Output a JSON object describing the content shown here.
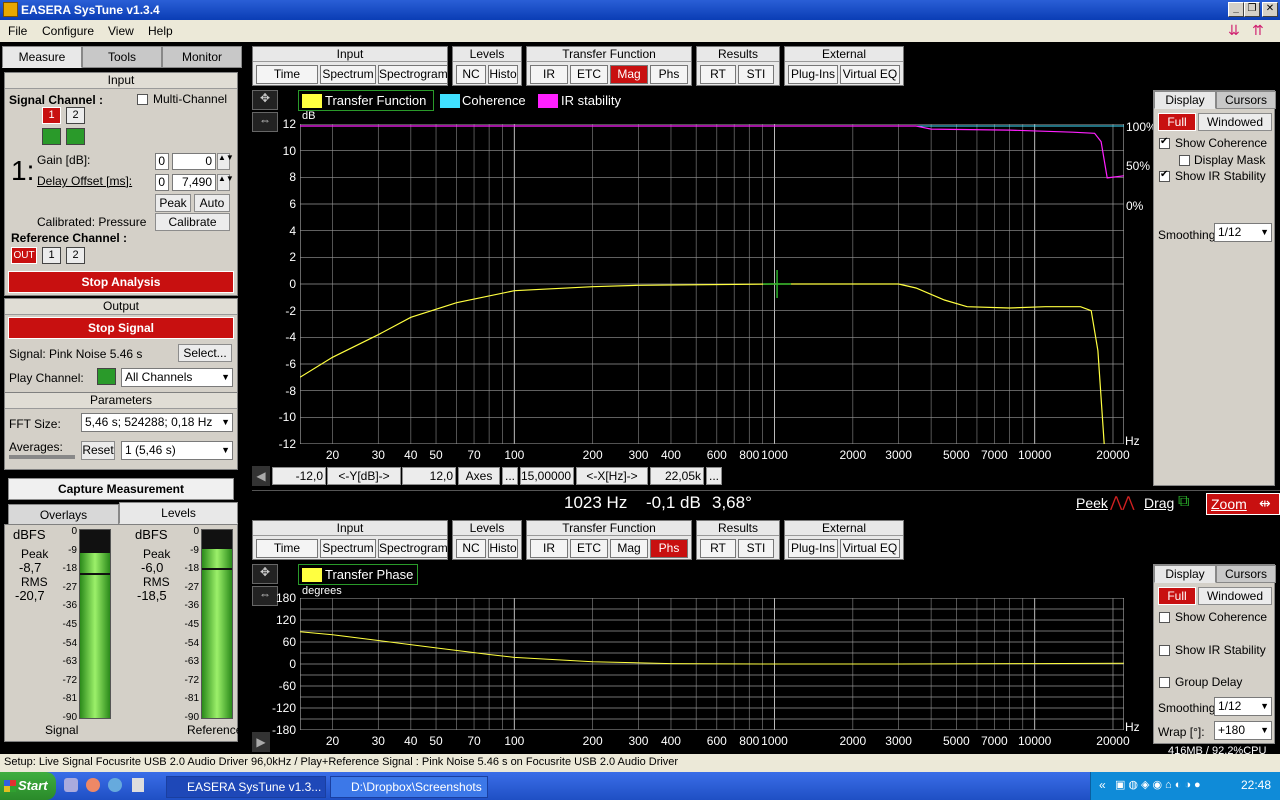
{
  "window": {
    "title": "EASERA SysTune v1.3.4"
  },
  "menu": [
    "File",
    "Configure",
    "View",
    "Help"
  ],
  "left_tabs": [
    "Measure",
    "Tools",
    "Monitor"
  ],
  "input": {
    "header": "Input",
    "signal_channel_label": "Signal Channel :",
    "multi_channel": "Multi-Channel",
    "channels": [
      "1",
      "2"
    ],
    "big_number": "1:",
    "gain_label": "Gain [dB]:",
    "gain_small": "0",
    "gain_value": "0",
    "delay_label": "Delay Offset [ms]:",
    "delay_small": "0",
    "delay_value": "7,490",
    "peak": "Peak",
    "auto": "Auto",
    "calibrated": "Calibrated: Pressure",
    "calibrate": "Calibrate",
    "reference_label": "Reference Channel :",
    "ref_channels": [
      "OUT",
      "1",
      "2"
    ],
    "stop_analysis": "Stop Analysis"
  },
  "output": {
    "header": "Output",
    "stop_signal": "Stop Signal",
    "signal": "Signal: Pink Noise  5.46 s",
    "select": "Select...",
    "play_channel": "Play Channel:",
    "play_value": "All Channels"
  },
  "parameters": {
    "header": "Parameters",
    "fft_label": "FFT Size:",
    "fft_value": "5,46 s; 524288; 0,18 Hz",
    "averages_label": "Averages:",
    "reset": "Reset",
    "avg_value": "1 (5,46 s)",
    "capture": "Capture Measurement"
  },
  "meters_tabs": [
    "Overlays",
    "Levels"
  ],
  "meters": [
    {
      "unit": "dBFS",
      "peak_label": "Peak",
      "peak": "-8,7",
      "rms_label": "RMS",
      "rms": "-20,7",
      "name": "Signal",
      "level": 0.88,
      "marker": 0.23
    },
    {
      "unit": "dBFS",
      "peak_label": "Peak",
      "peak": "-6,0",
      "rms_label": "RMS",
      "rms": "-18,5",
      "name": "Reference",
      "level": 0.9,
      "marker": 0.2
    }
  ],
  "meter_scale": [
    "0",
    "-9",
    "-18",
    "-27",
    "-36",
    "-45",
    "-54",
    "-63",
    "-72",
    "-81",
    "-90"
  ],
  "toolbar_top": {
    "groups": [
      {
        "title": "Input",
        "buttons": [
          "Time Signal",
          "Spectrum",
          "Spectrogram"
        ]
      },
      {
        "title": "Levels",
        "buttons": [
          "NC",
          "Histo"
        ]
      },
      {
        "title": "Transfer Function",
        "buttons": [
          "IR",
          "ETC",
          "Mag",
          "Phs"
        ]
      },
      {
        "title": "Results",
        "buttons": [
          "RT",
          "STI"
        ]
      },
      {
        "title": "External",
        "buttons": [
          "Plug-Ins",
          "Virtual EQ"
        ]
      }
    ],
    "active": "Mag"
  },
  "toolbar_bottom": {
    "active": "Phs"
  },
  "top_plot": {
    "legend": [
      "Transfer Function",
      "Coherence",
      "IR stability"
    ],
    "colors": {
      "tf": "#ffff40",
      "coh": "#40e0ff",
      "irs": "#ff20ff"
    },
    "yunit": "dB",
    "xunit": "Hz",
    "yticks": [
      "12",
      "10",
      "8",
      "6",
      "4",
      "2",
      "0",
      "-2",
      "-4",
      "-6",
      "-8",
      "-10",
      "-12"
    ],
    "right_ticks": [
      "100%",
      "50%",
      "0%"
    ],
    "xticks": [
      "20",
      "30",
      "40",
      "50",
      "70",
      "100",
      "200",
      "300",
      "400",
      "600",
      "800",
      "1000",
      "2000",
      "3000",
      "5000",
      "7000",
      "10000",
      "20000"
    ]
  },
  "axis_bar": {
    "ymin": "-12,0",
    "ylabel": "<-Y[dB]->",
    "ymax": "12,0",
    "axes": "Axes",
    "dots": "...",
    "xmin": "15,00000",
    "xlabel": "<-X[Hz]->",
    "xmax": "22,05k"
  },
  "readout": {
    "freq": "1023 Hz",
    "db": "-0,1 dB",
    "deg": "3,68°"
  },
  "modes": {
    "peek": "Peek",
    "drag": "Drag",
    "zoom": "Zoom"
  },
  "display_panel_top": {
    "tabs": [
      "Display",
      "Cursors"
    ],
    "full": "Full",
    "windowed": "Windowed",
    "show_coherence": "Show Coherence",
    "display_mask": "Display Mask",
    "show_ir": "Show IR Stability",
    "smoothing_label": "Smoothing:",
    "smoothing": "1/12"
  },
  "bottom_plot": {
    "legend": [
      "Transfer Phase"
    ],
    "yunit": "degrees",
    "yticks": [
      "180",
      "120",
      "60",
      "0",
      "-60",
      "-120",
      "-180"
    ]
  },
  "display_panel_bottom": {
    "tabs": [
      "Display",
      "Cursors"
    ],
    "full": "Full",
    "windowed": "Windowed",
    "show_coherence": "Show Coherence",
    "show_ir": "Show IR Stability",
    "group_delay": "Group Delay",
    "smoothing_label": "Smoothing:",
    "smoothing": "1/12",
    "wrap_label": "Wrap [°]:",
    "wrap": "+180"
  },
  "memory": "416MB / 92,2%CPU",
  "status": "Setup: Live Signal Focusrite USB 2.0 Audio Driver 96,0kHz / Play+Reference Signal : Pink Noise  5.46 s on Focusrite USB 2.0 Audio Driver",
  "taskbar": {
    "start": "Start",
    "items": [
      "EASERA SysTune v1.3...",
      "D:\\Dropbox\\Screenshots"
    ],
    "clock": "22:48"
  }
}
